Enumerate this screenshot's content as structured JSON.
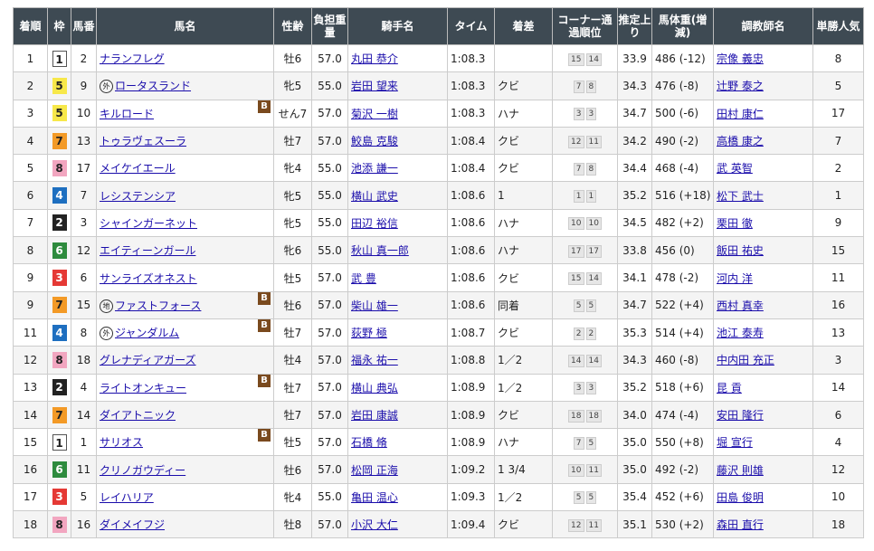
{
  "headers": [
    "着順",
    "枠",
    "馬番",
    "馬名",
    "性齢",
    "負担重量",
    "騎手名",
    "タイム",
    "着差",
    "コーナー通過順位",
    "推定上り",
    "馬体重(増減)",
    "調教師名",
    "単勝人気"
  ],
  "rows": [
    {
      "rank": "1",
      "waku": "1",
      "num": "2",
      "mark": "",
      "name": "ナランフレグ",
      "blink": "",
      "sexage": "牡6",
      "weight": "57.0",
      "jockey": "丸田 恭介",
      "time": "1:08.3",
      "margin": "",
      "corner": [
        "15",
        "14"
      ],
      "last3f": "33.9",
      "body": "486 (-12)",
      "trainer": "宗像 義忠",
      "pop": "8"
    },
    {
      "rank": "2",
      "waku": "5",
      "num": "9",
      "mark": "外",
      "name": "ロータスランド",
      "blink": "",
      "sexage": "牝5",
      "weight": "55.0",
      "jockey": "岩田 望来",
      "time": "1:08.3",
      "margin": "クビ",
      "corner": [
        "7",
        "8"
      ],
      "last3f": "34.3",
      "body": "476 (-8)",
      "trainer": "辻野 泰之",
      "pop": "5"
    },
    {
      "rank": "3",
      "waku": "5",
      "num": "10",
      "mark": "",
      "name": "キルロード",
      "blink": "B",
      "sexage": "せん7",
      "weight": "57.0",
      "jockey": "菊沢 一樹",
      "time": "1:08.3",
      "margin": "ハナ",
      "corner": [
        "3",
        "3"
      ],
      "last3f": "34.7",
      "body": "500 (-6)",
      "trainer": "田村 康仁",
      "pop": "17"
    },
    {
      "rank": "4",
      "waku": "7",
      "num": "13",
      "mark": "",
      "name": "トゥラヴェスーラ",
      "blink": "",
      "sexage": "牡7",
      "weight": "57.0",
      "jockey": "鮫島 克駿",
      "time": "1:08.4",
      "margin": "クビ",
      "corner": [
        "12",
        "11"
      ],
      "last3f": "34.2",
      "body": "490 (-2)",
      "trainer": "高橋 康之",
      "pop": "7"
    },
    {
      "rank": "5",
      "waku": "8",
      "num": "17",
      "mark": "",
      "name": "メイケイエール",
      "blink": "",
      "sexage": "牝4",
      "weight": "55.0",
      "jockey": "池添 謙一",
      "time": "1:08.4",
      "margin": "クビ",
      "corner": [
        "7",
        "8"
      ],
      "last3f": "34.4",
      "body": "468 (-4)",
      "trainer": "武 英智",
      "pop": "2"
    },
    {
      "rank": "6",
      "waku": "4",
      "num": "7",
      "mark": "",
      "name": "レシステンシア",
      "blink": "",
      "sexage": "牝5",
      "weight": "55.0",
      "jockey": "横山 武史",
      "time": "1:08.6",
      "margin": "1",
      "corner": [
        "1",
        "1"
      ],
      "last3f": "35.2",
      "body": "516 (+18)",
      "trainer": "松下 武士",
      "pop": "1"
    },
    {
      "rank": "7",
      "waku": "2",
      "num": "3",
      "mark": "",
      "name": "シャインガーネット",
      "blink": "",
      "sexage": "牝5",
      "weight": "55.0",
      "jockey": "田辺 裕信",
      "time": "1:08.6",
      "margin": "ハナ",
      "corner": [
        "10",
        "10"
      ],
      "last3f": "34.5",
      "body": "482 (+2)",
      "trainer": "栗田 徹",
      "pop": "9"
    },
    {
      "rank": "8",
      "waku": "6",
      "num": "12",
      "mark": "",
      "name": "エイティーンガール",
      "blink": "",
      "sexage": "牝6",
      "weight": "55.0",
      "jockey": "秋山 真一郎",
      "time": "1:08.6",
      "margin": "ハナ",
      "corner": [
        "17",
        "17"
      ],
      "last3f": "33.8",
      "body": "456 (0)",
      "trainer": "飯田 祐史",
      "pop": "15"
    },
    {
      "rank": "9",
      "waku": "3",
      "num": "6",
      "mark": "",
      "name": "サンライズオネスト",
      "blink": "",
      "sexage": "牡5",
      "weight": "57.0",
      "jockey": "武 豊",
      "time": "1:08.6",
      "margin": "クビ",
      "corner": [
        "15",
        "14"
      ],
      "last3f": "34.1",
      "body": "478 (-2)",
      "trainer": "河内 洋",
      "pop": "11"
    },
    {
      "rank": "9",
      "waku": "7",
      "num": "15",
      "mark": "地",
      "name": "ファストフォース",
      "blink": "B",
      "sexage": "牡6",
      "weight": "57.0",
      "jockey": "柴山 雄一",
      "time": "1:08.6",
      "margin": "同着",
      "corner": [
        "5",
        "5"
      ],
      "last3f": "34.7",
      "body": "522 (+4)",
      "trainer": "西村 真幸",
      "pop": "16"
    },
    {
      "rank": "11",
      "waku": "4",
      "num": "8",
      "mark": "外",
      "name": "ジャンダルム",
      "blink": "B",
      "sexage": "牡7",
      "weight": "57.0",
      "jockey": "荻野 極",
      "time": "1:08.7",
      "margin": "クビ",
      "corner": [
        "2",
        "2"
      ],
      "last3f": "35.3",
      "body": "514 (+4)",
      "trainer": "池江 泰寿",
      "pop": "13"
    },
    {
      "rank": "12",
      "waku": "8",
      "num": "18",
      "mark": "",
      "name": "グレナディアガーズ",
      "blink": "",
      "sexage": "牡4",
      "weight": "57.0",
      "jockey": "福永 祐一",
      "time": "1:08.8",
      "margin": "1／2",
      "corner": [
        "14",
        "14"
      ],
      "last3f": "34.3",
      "body": "460 (-8)",
      "trainer": "中内田 充正",
      "pop": "3"
    },
    {
      "rank": "13",
      "waku": "2",
      "num": "4",
      "mark": "",
      "name": "ライトオンキュー",
      "blink": "B",
      "sexage": "牡7",
      "weight": "57.0",
      "jockey": "横山 典弘",
      "time": "1:08.9",
      "margin": "1／2",
      "corner": [
        "3",
        "3"
      ],
      "last3f": "35.2",
      "body": "518 (+6)",
      "trainer": "昆 貢",
      "pop": "14"
    },
    {
      "rank": "14",
      "waku": "7",
      "num": "14",
      "mark": "",
      "name": "ダイアトニック",
      "blink": "",
      "sexage": "牡7",
      "weight": "57.0",
      "jockey": "岩田 康誠",
      "time": "1:08.9",
      "margin": "クビ",
      "corner": [
        "18",
        "18"
      ],
      "last3f": "34.0",
      "body": "474 (-4)",
      "trainer": "安田 隆行",
      "pop": "6"
    },
    {
      "rank": "15",
      "waku": "1",
      "num": "1",
      "mark": "",
      "name": "サリオス",
      "blink": "B",
      "sexage": "牡5",
      "weight": "57.0",
      "jockey": "石橋 脩",
      "time": "1:08.9",
      "margin": "ハナ",
      "corner": [
        "7",
        "5"
      ],
      "last3f": "35.0",
      "body": "550 (+8)",
      "trainer": "堀 宣行",
      "pop": "4"
    },
    {
      "rank": "16",
      "waku": "6",
      "num": "11",
      "mark": "",
      "name": "クリノガウディー",
      "blink": "",
      "sexage": "牡6",
      "weight": "57.0",
      "jockey": "松岡 正海",
      "time": "1:09.2",
      "margin": "1 3/4",
      "corner": [
        "10",
        "11"
      ],
      "last3f": "35.0",
      "body": "492 (-2)",
      "trainer": "藤沢 則雄",
      "pop": "12"
    },
    {
      "rank": "17",
      "waku": "3",
      "num": "5",
      "mark": "",
      "name": "レイハリア",
      "blink": "",
      "sexage": "牝4",
      "weight": "55.0",
      "jockey": "亀田 温心",
      "time": "1:09.3",
      "margin": "1／2",
      "corner": [
        "5",
        "5"
      ],
      "last3f": "35.4",
      "body": "452 (+6)",
      "trainer": "田島 俊明",
      "pop": "10"
    },
    {
      "rank": "18",
      "waku": "8",
      "num": "16",
      "mark": "",
      "name": "ダイメイフジ",
      "blink": "",
      "sexage": "牡8",
      "weight": "57.0",
      "jockey": "小沢 大仁",
      "time": "1:09.4",
      "margin": "クビ",
      "corner": [
        "12",
        "11"
      ],
      "last3f": "35.1",
      "body": "530 (+2)",
      "trainer": "森田 直行",
      "pop": "18"
    }
  ]
}
